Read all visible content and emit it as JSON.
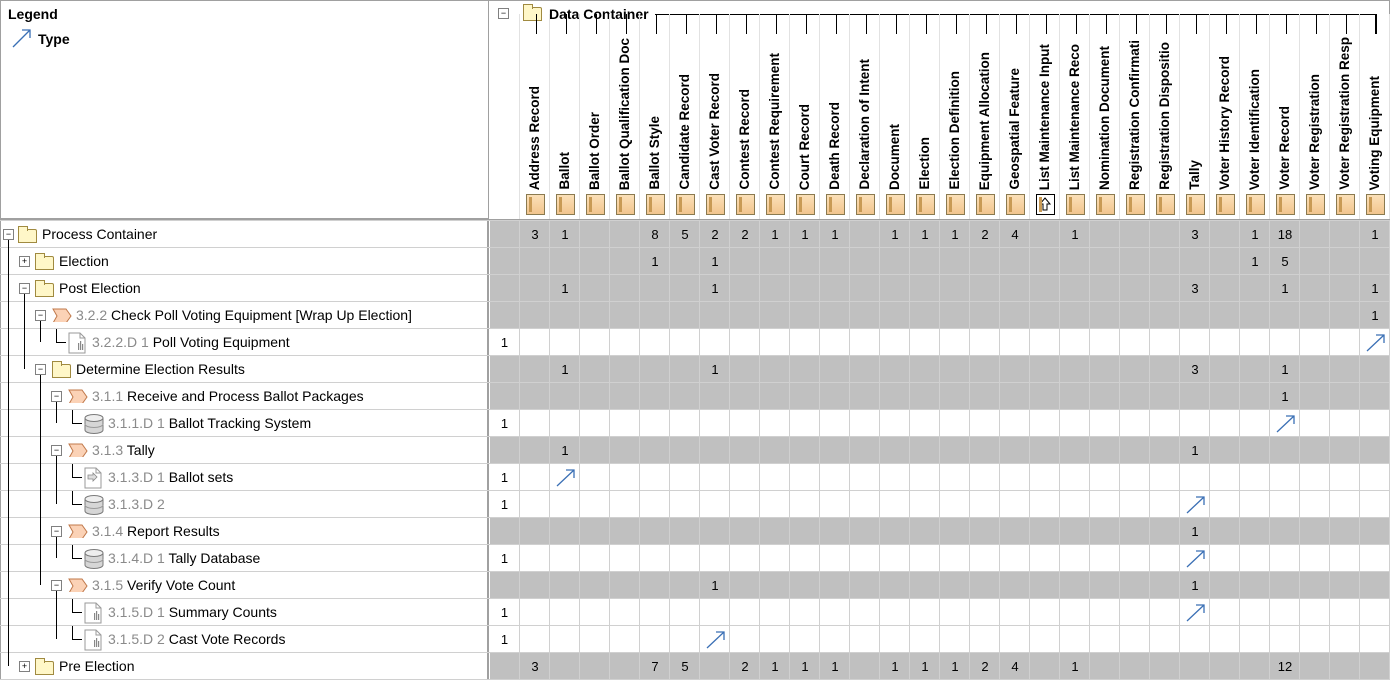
{
  "legend": {
    "title": "Legend",
    "type_label": "Type"
  },
  "data_container": {
    "label": "Data Container",
    "columns": [
      "Address Record",
      "Ballot",
      "Ballot Order",
      "Ballot Qualification Doc",
      "Ballot Style",
      "Candidate Record",
      "Cast Voter Record",
      "Contest Record",
      "Contest Requirement",
      "Court Record",
      "Death Record",
      "Declaration of Intent",
      "Document",
      "Election",
      "Election Definition",
      "Equipment Allocation",
      "Geospatial Feature",
      "List Maintenance Input",
      "List Maintenance Reco",
      "Nomination Document",
      "Registration Confirmati",
      "Registration Dispositio",
      "Tally",
      "Voter History Record",
      "Voter Identification",
      "Voter Record",
      "Voter Registration",
      "Voter Registration Resp",
      "Voting Equipment"
    ]
  },
  "colors": {
    "gray_row": "#c0c0c0",
    "arrow": "#3a6fb5",
    "grid": "#d0d0d0",
    "number_gray": "#8a8a8a"
  },
  "rows": [
    {
      "num": "",
      "label": "Process Container",
      "kind": "folder",
      "gray": true,
      "cells": {
        "0": "3",
        "1": "1",
        "4": "8",
        "5": "5",
        "6": "2",
        "7": "2",
        "8": "1",
        "9": "1",
        "10": "1",
        "12": "1",
        "13": "1",
        "14": "1",
        "15": "2",
        "16": "4",
        "18": "1",
        "22": "3",
        "24": "1",
        "25": "18",
        "28": "1"
      }
    },
    {
      "num": "",
      "label": "Election",
      "kind": "folder",
      "gray": true,
      "cells": {
        "4": "1",
        "6": "1",
        "24": "1",
        "25": "5"
      }
    },
    {
      "num": "",
      "label": "Post Election",
      "kind": "folder",
      "gray": true,
      "cells": {
        "1": "1",
        "6": "1",
        "22": "3",
        "25": "1",
        "28": "1"
      }
    },
    {
      "num": "3.2.2",
      "label": "Check Poll Voting Equipment [Wrap Up Election]",
      "kind": "process",
      "gray": true,
      "cells": {
        "28": "1"
      }
    },
    {
      "num": "3.2.2.D 1",
      "label": "Poll Voting Equipment",
      "kind": "doc",
      "gray": false,
      "count": "1",
      "arrows": [
        28
      ]
    },
    {
      "num": "",
      "label": "Determine Election Results",
      "kind": "folder",
      "gray": true,
      "cells": {
        "1": "1",
        "6": "1",
        "22": "3",
        "25": "1"
      }
    },
    {
      "num": "3.1.1",
      "label": "Receive and Process Ballot Packages",
      "kind": "process",
      "gray": true,
      "cells": {
        "25": "1"
      }
    },
    {
      "num": "3.1.1.D 1",
      "label": "Ballot Tracking System",
      "kind": "db",
      "gray": false,
      "count": "1",
      "arrows": [
        25
      ]
    },
    {
      "num": "3.1.3",
      "label": "Tally",
      "kind": "process",
      "gray": true,
      "cells": {
        "1": "1",
        "22": "1"
      }
    },
    {
      "num": "3.1.3.D 1",
      "label": "Ballot sets",
      "kind": "docarrow",
      "gray": false,
      "count": "1",
      "arrows": [
        1
      ]
    },
    {
      "num": "3.1.3.D 2",
      "label": "",
      "kind": "db",
      "gray": false,
      "count": "1",
      "arrows": [
        22
      ]
    },
    {
      "num": "3.1.4",
      "label": "Report Results",
      "kind": "process",
      "gray": true,
      "cells": {
        "22": "1"
      }
    },
    {
      "num": "3.1.4.D 1",
      "label": "Tally Database",
      "kind": "db",
      "gray": false,
      "count": "1",
      "arrows": [
        22
      ]
    },
    {
      "num": "3.1.5",
      "label": "Verify Vote Count",
      "kind": "process",
      "gray": true,
      "cells": {
        "6": "1",
        "22": "1"
      }
    },
    {
      "num": "3.1.5.D 1",
      "label": "Summary Counts",
      "kind": "doc",
      "gray": false,
      "count": "1",
      "arrows": [
        22
      ]
    },
    {
      "num": "3.1.5.D 2",
      "label": "Cast Vote Records",
      "kind": "doc",
      "gray": false,
      "count": "1",
      "arrows": [
        6
      ]
    },
    {
      "num": "",
      "label": "Pre Election",
      "kind": "folder",
      "gray": true,
      "cells": {
        "0": "3",
        "4": "7",
        "5": "5",
        "7": "2",
        "8": "1",
        "9": "1",
        "10": "1",
        "12": "1",
        "13": "1",
        "14": "1",
        "15": "2",
        "16": "4",
        "18": "1",
        "25": "12"
      }
    }
  ]
}
